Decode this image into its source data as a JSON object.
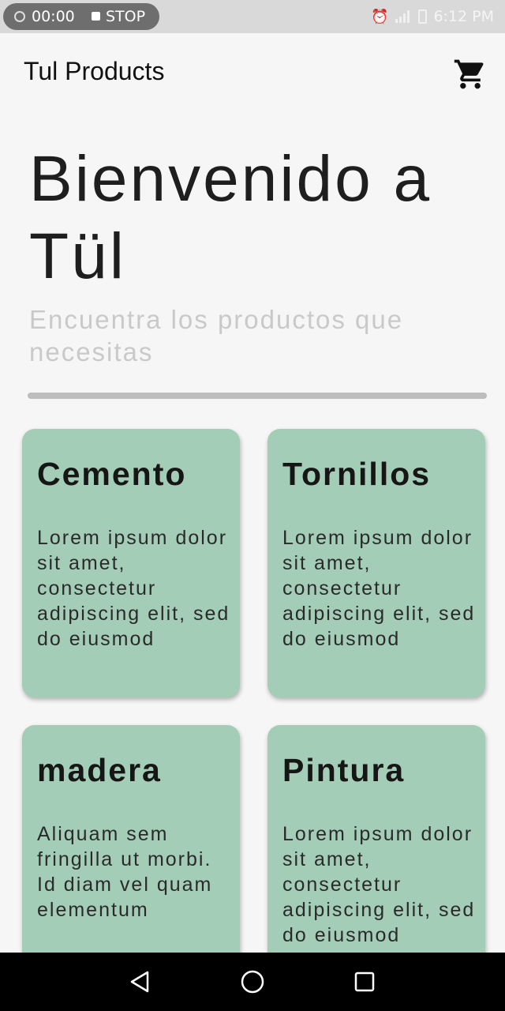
{
  "status_bar": {
    "record_time": "00:00",
    "stop_label": "STOP",
    "clock": "6:12 PM",
    "icons": [
      "alarm-icon",
      "signal-icon",
      "battery-icon"
    ]
  },
  "app_bar": {
    "title": "Tul Products",
    "cart_icon": "cart-icon"
  },
  "hero": {
    "title": "Bienvenido a Tül",
    "subtitle": "Encuentra los productos que necesitas"
  },
  "cards": [
    {
      "title": "Cemento",
      "description": "Lorem ipsum dolor sit amet, consectetur adipiscing elit, sed do eiusmod"
    },
    {
      "title": "Tornillos",
      "description": "Lorem ipsum dolor sit amet, consectetur adipiscing elit, sed do eiusmod"
    },
    {
      "title": "madera",
      "description": "Aliquam sem fringilla ut morbi. Id diam vel quam elementum"
    },
    {
      "title": "Pintura",
      "description": "Lorem ipsum dolor sit amet, consectetur adipiscing elit, sed do eiusmod"
    }
  ],
  "nav_bar": {
    "icons": [
      "back-icon",
      "home-icon",
      "recents-icon"
    ]
  },
  "colors": {
    "card_background": "#a3cdb7",
    "page_background": "#f6f6f6",
    "subtitle_color": "#c9c9c9",
    "divider_color": "#bdbdbd"
  }
}
